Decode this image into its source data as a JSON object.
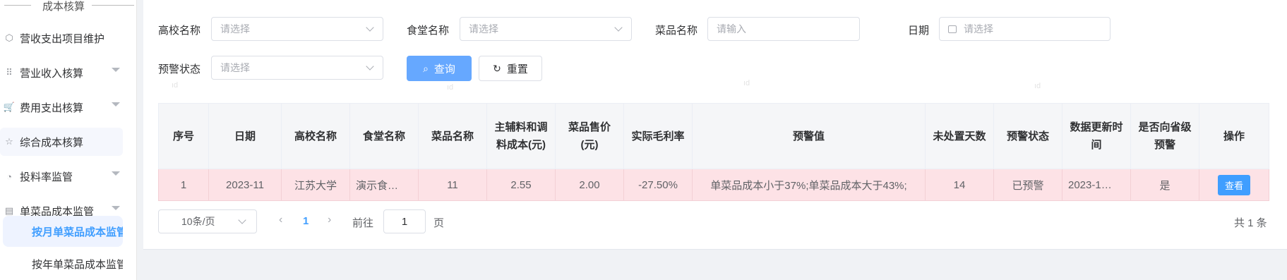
{
  "sidebar": {
    "group_title": "成本核算",
    "items": [
      {
        "label": "营收支出项目维护",
        "icon": "tag-icon",
        "glyph": "⬡",
        "has_chevron": false
      },
      {
        "label": "营业收入核算",
        "icon": "grid-icon",
        "glyph": "⠿",
        "has_chevron": true
      },
      {
        "label": "费用支出核算",
        "icon": "cart-icon",
        "glyph": "🛒",
        "has_chevron": true
      },
      {
        "label": "综合成本核算",
        "icon": "star-icon",
        "glyph": "☆",
        "has_chevron": false
      },
      {
        "label": "投料率监管",
        "icon": "palette-icon",
        "glyph": "◔",
        "has_chevron": true
      },
      {
        "label": "单菜品成本监管",
        "icon": "document-icon",
        "glyph": "▤",
        "has_chevron": true
      }
    ],
    "sub_items": [
      {
        "label": "按月单菜品成本监管",
        "active": true
      },
      {
        "label": "按年单菜品成本监管",
        "active": false
      }
    ]
  },
  "filters": {
    "school": {
      "label": "高校名称",
      "placeholder": "请选择"
    },
    "canteen": {
      "label": "食堂名称",
      "placeholder": "请选择"
    },
    "dish": {
      "label": "菜品名称",
      "placeholder": "请输入"
    },
    "date": {
      "label": "日期",
      "placeholder": "请选择"
    },
    "alert_status": {
      "label": "预警状态",
      "placeholder": "请选择"
    }
  },
  "buttons": {
    "query": "查询",
    "reset": "重置"
  },
  "table": {
    "columns": [
      "序号",
      "日期",
      "高校名称",
      "食堂名称",
      "菜品名称",
      "主辅料和调料成本(元)",
      "菜品售价(元)",
      "实际毛利率",
      "预警值",
      "未处置天数",
      "预警状态",
      "数据更新时间",
      "是否向省级预警",
      "操作"
    ],
    "rows": [
      {
        "index": "1",
        "date": "2023-11",
        "school": "江苏大学",
        "canteen": "演示食…",
        "dish": "11",
        "cost": "2.55",
        "price": "2.00",
        "margin": "-27.50%",
        "threshold": "单菜品成本小于37%;单菜品成本大于43%;",
        "days": "14",
        "status": "已预警",
        "updated": "2023-1…",
        "provincial": "是",
        "action": "查看"
      }
    ]
  },
  "pagination": {
    "page_size": "10条/页",
    "prev": "‹",
    "current_page": "1",
    "next": "›",
    "goto_label": "前往",
    "goto_value": "1",
    "page_unit": "页",
    "total": "共 1 条"
  },
  "colors": {
    "primary": "#409eff",
    "row_alert_bg": "#fde2e6",
    "header_bg": "#f5f6f8"
  }
}
